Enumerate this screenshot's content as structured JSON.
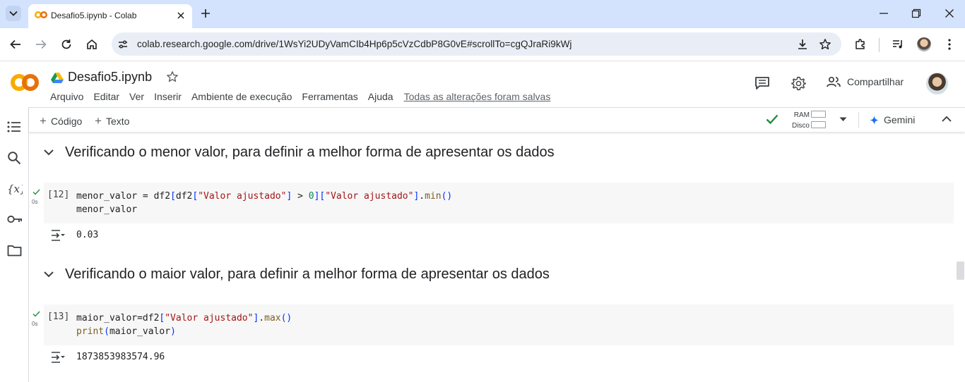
{
  "browser": {
    "tab_title": "Desafio5.ipynb - Colab",
    "url": "colab.research.google.com/drive/1WsYi2UDyVamCIb4Hp6p5cVzCdbP8G0vE#scrollTo=cgQJraRi9kWj"
  },
  "notebook": {
    "title": "Desafio5.ipynb",
    "menu": [
      "Arquivo",
      "Editar",
      "Ver",
      "Inserir",
      "Ambiente de execução",
      "Ferramentas",
      "Ajuda"
    ],
    "save_status": "Todas as alterações foram salvas",
    "share_label": "Compartilhar"
  },
  "toolbar": {
    "add_code": "Código",
    "add_text": "Texto",
    "ram_label": "RAM",
    "disk_label": "Disco",
    "gemini_label": "Gemini"
  },
  "cells": [
    {
      "heading": "Verificando o menor valor, para definir a melhor forma de apresentar os dados",
      "exec_count": "[12]",
      "status": "0s",
      "output": "0.03"
    },
    {
      "heading": "Verificando o maior valor, para definir a melhor forma de apresentar os dados",
      "exec_count": "[13]",
      "status": "0s",
      "output": "1873853983574.96"
    }
  ],
  "colors": {
    "tab_strip": "#d3e3fd",
    "omnibox": "#e9eef6",
    "colab_orange": "#f9ab00",
    "check_green": "#1e8e3e",
    "gemini_blue": "#1a73e8"
  }
}
